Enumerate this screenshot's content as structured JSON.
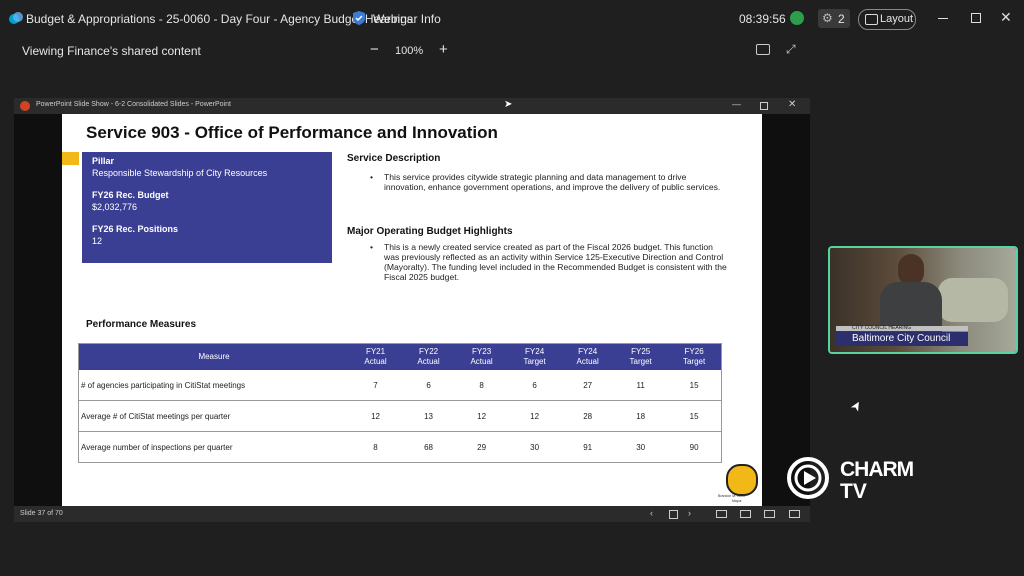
{
  "header": {
    "meeting_title": "Budget & Appropriations - 25-0060 - Day Four - Agency Budget Hearings",
    "webinar_info": "Webinar Info",
    "time": "08:39:56",
    "participants_count": "2",
    "layout_label": "Layout"
  },
  "share_bar": {
    "sharing_text": "Viewing Finance's shared content",
    "zoom": "100%",
    "minus": "−",
    "plus": "+"
  },
  "ppt": {
    "window_title": "PowerPoint Slide Show  -  6-2 Consolidated Slides - PowerPoint",
    "slide_status": "Slide 37 of 70"
  },
  "slide": {
    "title": "Service 903 - Office of Performance and Innovation",
    "pillar_label": "Pillar",
    "pillar_value": "Responsible Stewardship of City Resources",
    "budget_label": "FY26 Rec. Budget",
    "budget_value": "$2,032,776",
    "positions_label": "FY26 Rec. Positions",
    "positions_value": "12",
    "service_desc_heading": "Service Description",
    "service_desc_text": "This service provides citywide strategic planning and data management to drive innovation, enhance government operations, and improve the delivery of public services.",
    "highlights_heading": "Major Operating Budget Highlights",
    "highlights_text": "This is a newly created service created as part of the Fiscal 2026 budget. This function was previously reflected as an activity within Service 125-Executive Direction and Control (Mayoralty). The funding level included in the Recommended Budget is consistent with the Fiscal 2025 budget.",
    "perf_heading": "Performance Measures",
    "table": {
      "headers": [
        [
          "Measure",
          ""
        ],
        [
          "FY21",
          "Actual"
        ],
        [
          "FY22",
          "Actual"
        ],
        [
          "FY23",
          "Actual"
        ],
        [
          "FY24",
          "Target"
        ],
        [
          "FY24",
          "Actual"
        ],
        [
          "FY25",
          "Target"
        ],
        [
          "FY26",
          "Target"
        ]
      ],
      "rows": [
        [
          "# of agencies participating in CitiStat meetings",
          "7",
          "6",
          "8",
          "6",
          "27",
          "11",
          "15"
        ],
        [
          "Average # of CitiStat meetings per quarter",
          "12",
          "13",
          "12",
          "12",
          "28",
          "18",
          "15"
        ],
        [
          "Average number of inspections per quarter",
          "8",
          "68",
          "29",
          "30",
          "91",
          "30",
          "90"
        ]
      ]
    },
    "seal_caption_1": "Brandon M. Scott",
    "seal_caption_2": "Mayor"
  },
  "webcam": {
    "lower_third_top": "CITY COUNCIL HEARING",
    "lower_third_name": "Baltimore City Council"
  },
  "brand": {
    "line1": "CHARM",
    "line2": "TV"
  },
  "colors": {
    "slide_blue": "#3b3f93",
    "accent_yellow": "#f2b818",
    "cam_border": "#57d3a0",
    "presence_green": "#2e9e4a"
  }
}
